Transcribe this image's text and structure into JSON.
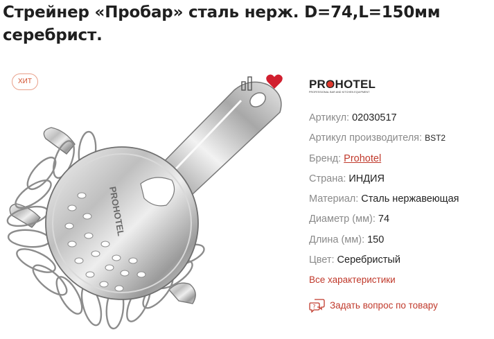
{
  "product": {
    "title": "Стрейнер «Пробар» сталь нерж. D=74,L=150мм серебрист.",
    "badge": "ХИТ",
    "image_imprint": "PROHOTEL"
  },
  "brand_logo": {
    "text_pre": "PR",
    "text_o": "O",
    "text_post": "HOTEL",
    "subtitle": "PROFESSIONAL BAR AND KITCHEN EQUIPMENT"
  },
  "specs": [
    {
      "label": "Артикул:",
      "value": "02030517"
    },
    {
      "label": "Артикул производителя:",
      "value": "BST2"
    },
    {
      "label": "Бренд:",
      "value": "Prohotel"
    },
    {
      "label": "Страна:",
      "value": "ИНДИЯ"
    },
    {
      "label": "Материал:",
      "value": "Сталь нержавеющая"
    },
    {
      "label": "Диаметр (мм):",
      "value": "74"
    },
    {
      "label": "Длина (мм):",
      "value": "150"
    },
    {
      "label": "Цвет:",
      "value": "Серебристый"
    }
  ],
  "actions": {
    "all_specs": "Все характеристики",
    "ask_question": "Задать вопрос по товару"
  },
  "icons": {
    "compare": "compare-icon",
    "favorite": "heart-icon",
    "ask": "chat-question-icon"
  },
  "colors": {
    "accent": "#c0392b",
    "heart": "#d11f2f",
    "badge": "#d2512f",
    "label": "#8a8a8a"
  }
}
